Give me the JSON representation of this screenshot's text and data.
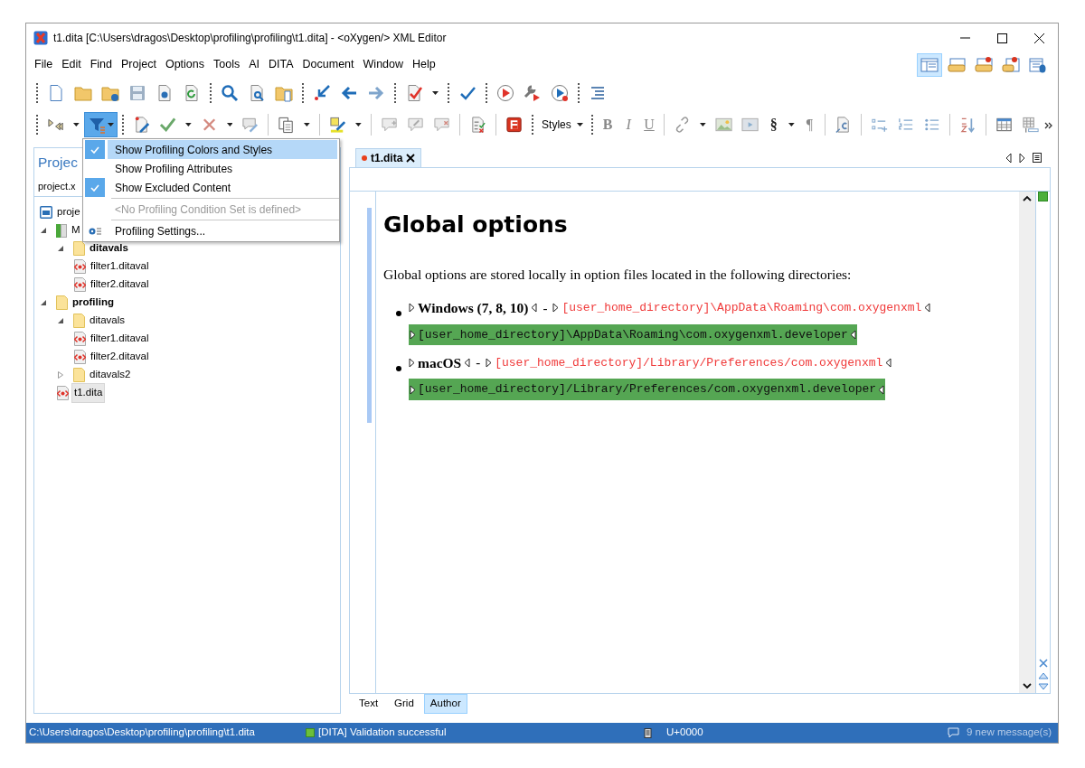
{
  "window": {
    "title": "t1.dita [C:\\Users\\dragos\\Desktop\\profiling\\profiling\\t1.dita] - <oXygen/> XML Editor"
  },
  "menu_bar": [
    "File",
    "Edit",
    "Find",
    "Project",
    "Options",
    "Tools",
    "AI",
    "DITA",
    "Document",
    "Window",
    "Help"
  ],
  "perspectives": [
    {
      "selected": true
    },
    {
      "selected": false
    },
    {
      "selected": false
    },
    {
      "selected": false
    },
    {
      "selected": false
    }
  ],
  "toolbar": {
    "filter_button": {
      "pressed": true
    },
    "styles_dropdown": "Styles",
    "format_buttons": [
      "B",
      "I",
      "U"
    ],
    "section_button": "§",
    "pilcrow_button": "¶"
  },
  "profiling_menu": {
    "groups": [
      [
        {
          "kind": "check",
          "label": "Show Profiling Colors and Styles",
          "checked": true,
          "selected": true,
          "disabled": false
        },
        {
          "kind": "check",
          "label": "Show Profiling Attributes",
          "checked": false,
          "selected": false,
          "disabled": false
        },
        {
          "kind": "check",
          "label": "Show Excluded Content",
          "checked": true,
          "selected": false,
          "disabled": false
        }
      ],
      [
        {
          "kind": "info",
          "label": "<No Profiling Condition Set is defined>",
          "selected": false,
          "disabled": true
        }
      ],
      [
        {
          "kind": "settings",
          "label": "Profiling Settings...",
          "selected": false,
          "disabled": false
        }
      ]
    ]
  },
  "project_panel": {
    "title": "Projec",
    "project_file": "project.x",
    "tree": [
      {
        "kind": "project",
        "label": "proje",
        "bold": false,
        "selected": false
      },
      {
        "kind": "library",
        "label": "M",
        "bold": false,
        "selected": false,
        "expanded": true,
        "children": [
          {
            "kind": "folder",
            "label": "ditavals",
            "bold": true,
            "selected": false,
            "expanded": true,
            "children": [
              {
                "kind": "file",
                "label": "filter1.ditaval",
                "bold": false,
                "selected": false
              },
              {
                "kind": "file",
                "label": "filter2.ditaval",
                "bold": false,
                "selected": false
              }
            ]
          }
        ]
      },
      {
        "kind": "folder",
        "label": "profiling",
        "bold": true,
        "selected": false,
        "expanded": true,
        "children": [
          {
            "kind": "folder",
            "label": "ditavals",
            "bold": false,
            "selected": false,
            "expanded": true,
            "children": [
              {
                "kind": "file",
                "label": "filter1.ditaval",
                "bold": false,
                "selected": false
              },
              {
                "kind": "file",
                "label": "filter2.ditaval",
                "bold": false,
                "selected": false
              }
            ]
          },
          {
            "kind": "folder",
            "label": "ditavals2",
            "bold": false,
            "selected": false,
            "expanded": false
          },
          {
            "kind": "file",
            "label": "t1.dita",
            "bold": false,
            "selected": true
          }
        ]
      }
    ]
  },
  "editor": {
    "tabs": [
      {
        "label": "t1.dita",
        "modified": true,
        "selected": true
      }
    ],
    "heading": "Global options",
    "paragraph": "Global options are stored locally in option files located in the following directories:",
    "items": [
      {
        "label": "Windows (7, 8, 10)",
        "separator": "-",
        "path": "[user_home_directory]\\AppData\\Roaming\\com.oxygenxml",
        "profiled_path": "[user_home_directory]\\AppData\\Roaming\\com.oxygenxml.developer"
      },
      {
        "label": "macOS",
        "separator": "-",
        "path": "[user_home_directory]/Library/Preferences/com.oxygenxml",
        "profiled_path": "[user_home_directory]/Library/Preferences/com.oxygenxml.developer"
      }
    ],
    "mode_tabs": [
      {
        "label": "Text",
        "selected": false
      },
      {
        "label": "Grid",
        "selected": false
      },
      {
        "label": "Author",
        "selected": true
      }
    ]
  },
  "status_bar": {
    "path": "C:\\Users\\dragos\\Desktop\\profiling\\profiling\\t1.dita",
    "validation": "[DITA] Validation successful",
    "encoding": "U+0000",
    "messages": "9 new message(s)"
  }
}
